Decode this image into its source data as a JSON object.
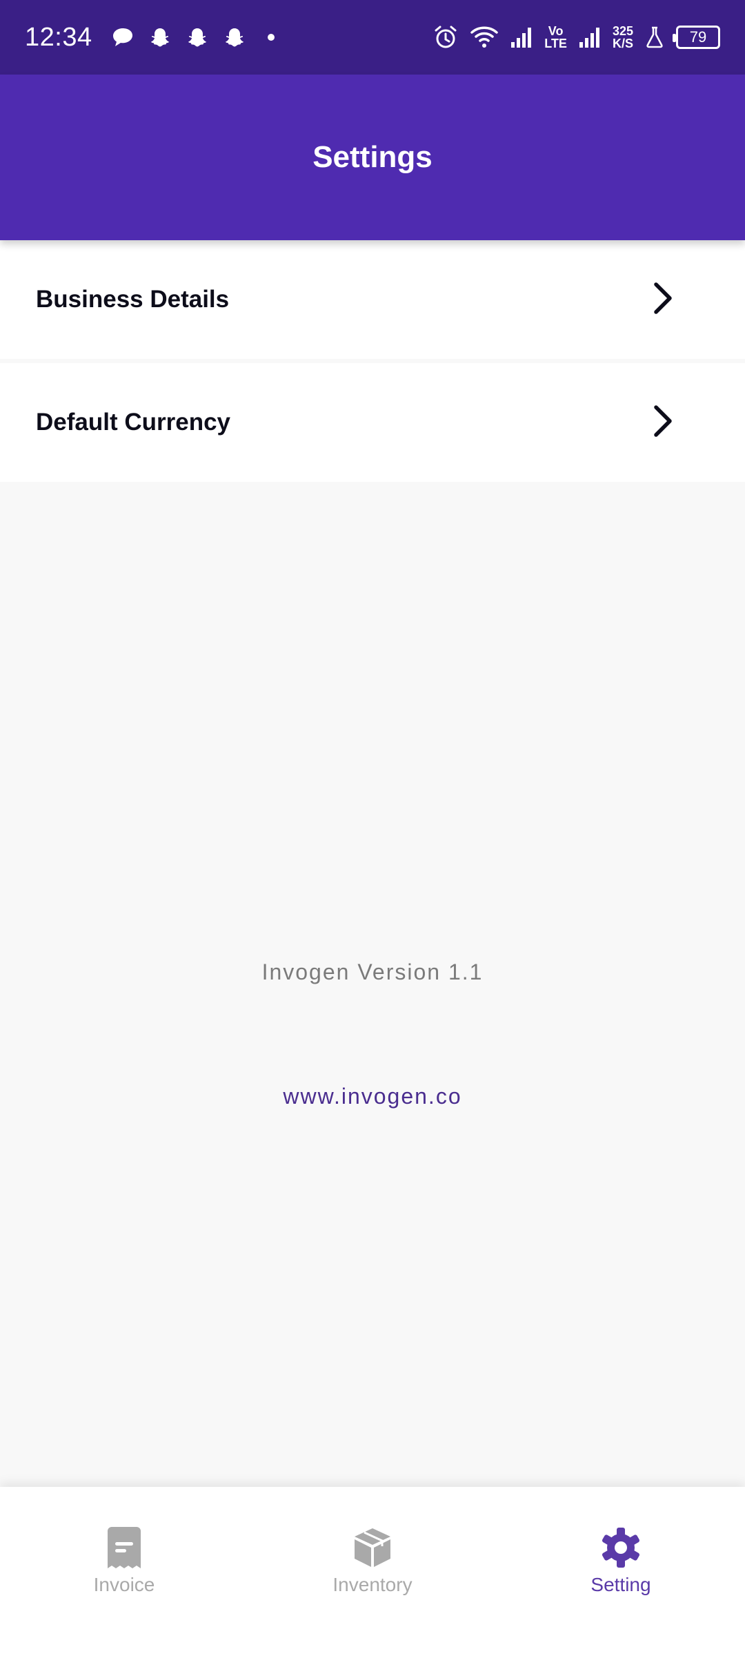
{
  "status_bar": {
    "time": "12:34",
    "network_speed_value": "325",
    "network_speed_unit": "K/S",
    "volte_top": "Vo",
    "volte_bottom": "LTE",
    "battery": "79"
  },
  "header": {
    "title": "Settings"
  },
  "settings": {
    "items": [
      {
        "label": "Business Details"
      },
      {
        "label": "Default Currency"
      }
    ]
  },
  "info": {
    "version": "Invogen Version 1.1",
    "website": "www.invogen.co"
  },
  "bottom_nav": {
    "items": [
      {
        "label": "Invoice",
        "icon": "invoice-icon",
        "active": false
      },
      {
        "label": "Inventory",
        "icon": "box-icon",
        "active": false
      },
      {
        "label": "Setting",
        "icon": "gear-icon",
        "active": true
      }
    ]
  },
  "colors": {
    "status_bar": "#3a1f86",
    "header": "#4f2bb0",
    "active_nav": "#5a3aa8",
    "inactive_nav": "#a9a9a9"
  }
}
